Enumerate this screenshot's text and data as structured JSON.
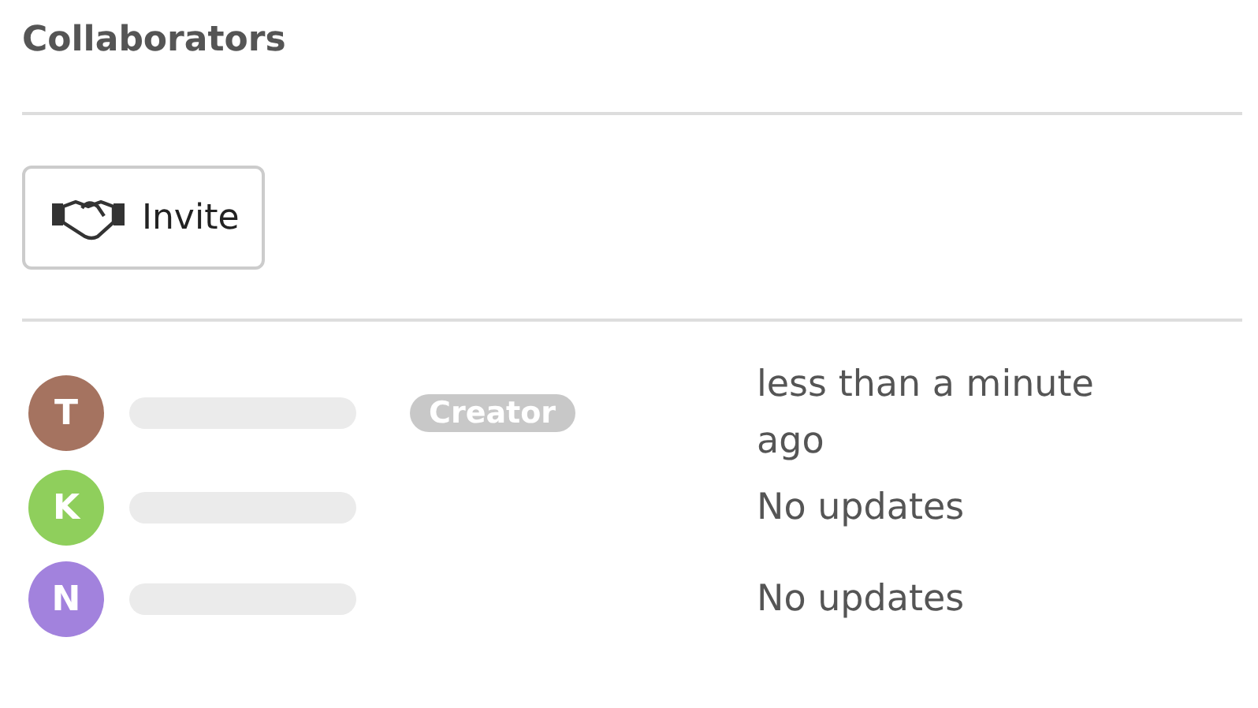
{
  "title": "Collaborators",
  "invite_button": {
    "label": "Invite"
  },
  "collaborators": [
    {
      "initial": "T",
      "color": "#a57360",
      "badge": "Creator",
      "status": "less than a minute ago"
    },
    {
      "initial": "K",
      "color": "#8fcf5c",
      "status": "No updates"
    },
    {
      "initial": "N",
      "color": "#a282dd",
      "status": "No updates"
    }
  ]
}
